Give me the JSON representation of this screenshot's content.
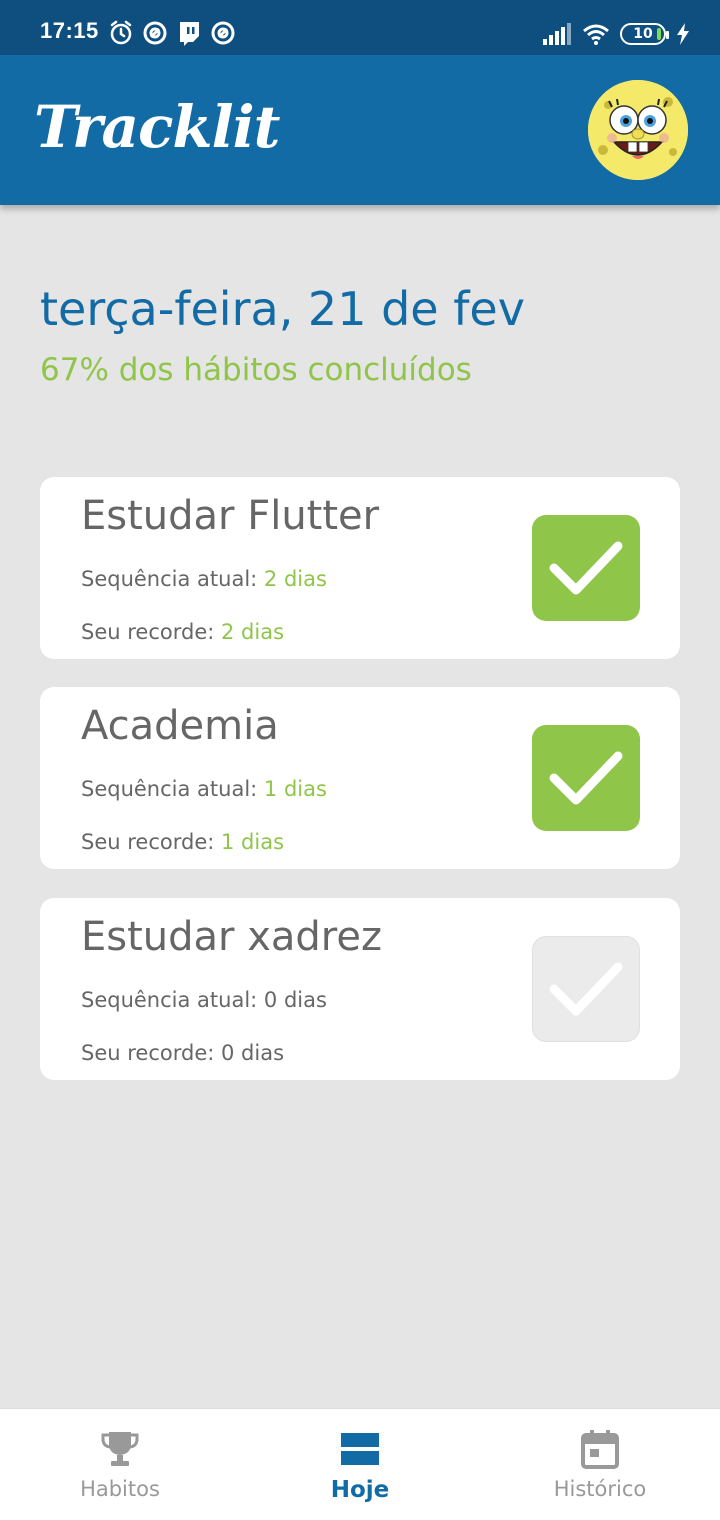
{
  "status_bar": {
    "time": "17:15",
    "battery": "10",
    "icons_left": [
      "alarm-icon",
      "at-sign-icon",
      "twitch-icon",
      "at-sign-icon"
    ],
    "icons_right": [
      "signal-icon",
      "wifi-icon",
      "battery-icon",
      "charging-bolt-icon"
    ]
  },
  "header": {
    "logo": "Tracklit",
    "avatar": "user-avatar"
  },
  "today": {
    "date": "terça-feira, 21 de fev",
    "progress": "67% dos hábitos concluídos",
    "progress_value": 0.67
  },
  "habits": [
    {
      "name": "Estudar Flutter",
      "current_label": "Sequência atual:",
      "current_value": "2 dias",
      "record_label": "Seu recorde:",
      "record_value": "2 dias",
      "done": true
    },
    {
      "name": "Academia",
      "current_label": "Sequência atual:",
      "current_value": "1 dias",
      "record_label": "Seu recorde:",
      "record_value": "1 dias",
      "done": true
    },
    {
      "name": "Estudar xadrez",
      "current_label": "Sequência atual:",
      "current_value": "0 dias",
      "record_label": "Seu recorde:",
      "record_value": "0 dias",
      "done": false
    }
  ],
  "colors": {
    "primary": "#126ba5",
    "status_bar": "#0f4f80",
    "accent_green": "#8fc549",
    "background": "#e5e5e5",
    "text_gray": "#666666",
    "inactive_gray": "#999999"
  },
  "bottom_nav": {
    "items": [
      {
        "label": "Habitos",
        "icon": "trophy-icon",
        "active": false
      },
      {
        "label": "Hoje",
        "icon": "today-list-icon",
        "active": true
      },
      {
        "label": "Histórico",
        "icon": "calendar-icon",
        "active": false
      }
    ]
  }
}
